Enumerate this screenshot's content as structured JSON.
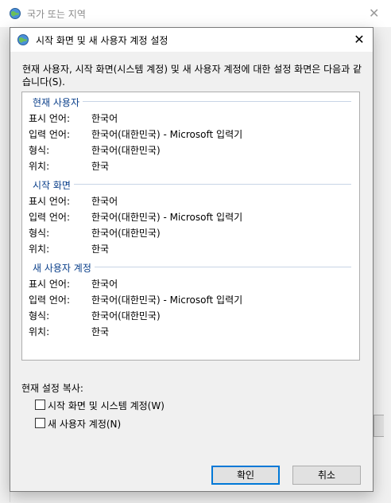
{
  "background_window": {
    "title": "국가 또는 지역",
    "close_glyph": "✕"
  },
  "dialog": {
    "title": "시작 화면 및 새 사용자 계정 설정",
    "close_glyph": "✕",
    "description": "현재 사용자, 시작 화면(시스템 계정) 및 새 사용자 계정에 대한 설정 화면은 다음과 같습니다(S).",
    "groups": [
      {
        "header": "현재 사용자",
        "rows": [
          {
            "label": "표시 언어:",
            "value": "한국어"
          },
          {
            "label": "입력 언어:",
            "value": "한국어(대한민국) - Microsoft 입력기"
          },
          {
            "label": "형식:",
            "value": "한국어(대한민국)"
          },
          {
            "label": "위치:",
            "value": "한국"
          }
        ]
      },
      {
        "header": "시작 화면",
        "rows": [
          {
            "label": "표시 언어:",
            "value": "한국어"
          },
          {
            "label": "입력 언어:",
            "value": "한국어(대한민국) - Microsoft 입력기"
          },
          {
            "label": "형식:",
            "value": "한국어(대한민국)"
          },
          {
            "label": "위치:",
            "value": "한국"
          }
        ]
      },
      {
        "header": "새 사용자 계정",
        "rows": [
          {
            "label": "표시 언어:",
            "value": "한국어"
          },
          {
            "label": "입력 언어:",
            "value": "한국어(대한민국) - Microsoft 입력기"
          },
          {
            "label": "형식:",
            "value": "한국어(대한민국)"
          },
          {
            "label": "위치:",
            "value": "한국"
          }
        ]
      }
    ],
    "copy_section": {
      "label": "현재 설정 복사:",
      "checkboxes": [
        {
          "label": "시작 화면 및 시스템 계정(W)",
          "checked": false
        },
        {
          "label": "새 사용자 계정(N)",
          "checked": false
        }
      ]
    },
    "buttons": {
      "ok": "확인",
      "cancel": "취소"
    }
  },
  "colors": {
    "group_header": "#0a3f8a",
    "focus_border": "#0078d7"
  },
  "icons": {
    "title_icon": "globe-icon",
    "close": "close-icon",
    "checkbox": "checkbox-icon"
  }
}
